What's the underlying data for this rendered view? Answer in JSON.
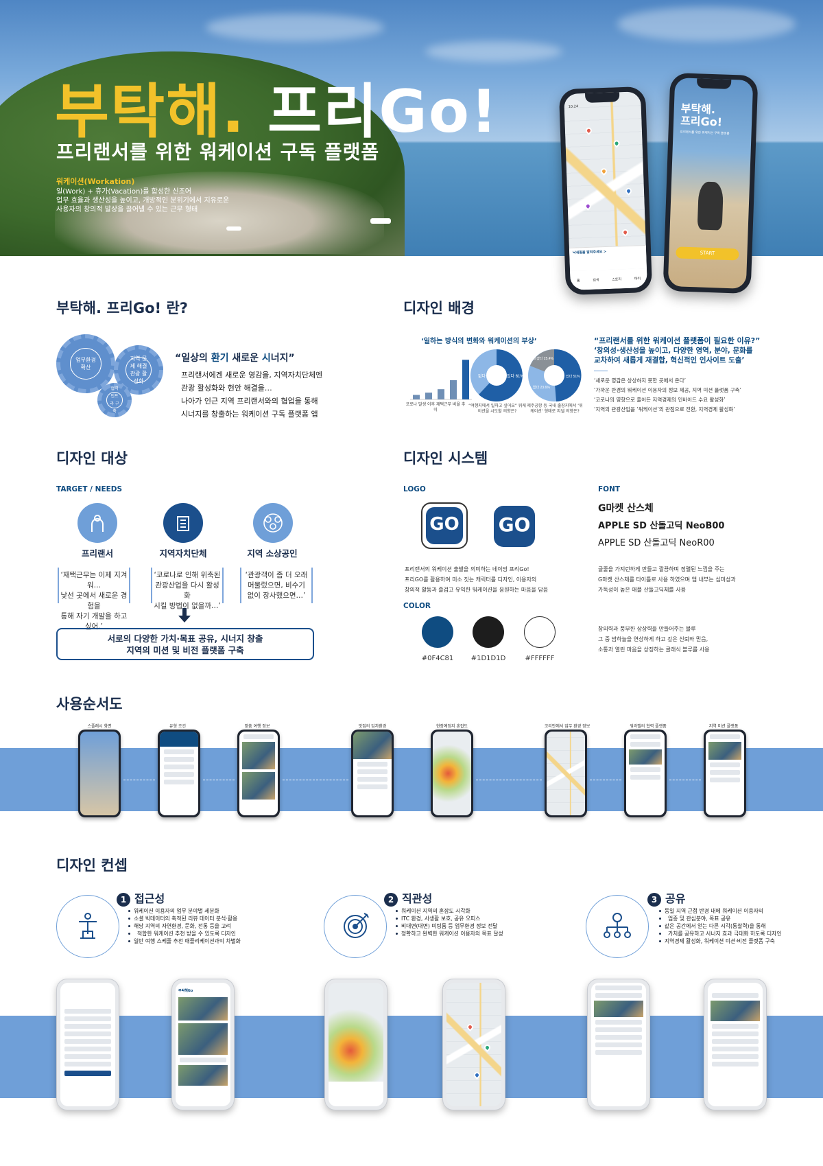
{
  "hero": {
    "title_yellow": "부탁해.",
    "title_white": "프리Go!",
    "subtitle": "프리랜서를 위한 워케이션 구독 플랫폼",
    "work_title": "워케이션(Workation)",
    "work_lines": [
      "일(Work) + 휴가(Vacation)를 합성한 신조어",
      "업무 효율과 생산성을 높이고, 개방적인 분위기에서 지유로운",
      "사용자의 창의적 발상을 끌어낼 수 있는 근무 형태"
    ],
    "phone1": {
      "time": "10:24",
      "label": "내 주변 여행지",
      "nav": [
        "홈",
        "검색",
        "스토리",
        "마이"
      ],
      "bottom_title": "낙새필을 알려주세요 >"
    },
    "phone2": {
      "title_line1": "부탁해.",
      "title_line2": "프리Go!",
      "subtitle": "프리랜서를 위한 워케이션 구독 플랫폼",
      "start": "START"
    }
  },
  "about": {
    "heading": "부탁해. 프리Go! 란?",
    "gears": [
      "업무환경 확산",
      "지역 문제 해결 관광 활성화",
      "협력 인프라 구축"
    ],
    "quote_prefix": "“일상의 ",
    "quote_bold1": "환기",
    "quote_mid": " 새로운 ",
    "quote_bold2": "시",
    "quote_suffix": "너지”",
    "body": [
      "프리랜서에겐 새로운 영감을, 지역자치단체엔",
      "관광 활성화와 현안 해결을…",
      "나아가 인근 지역 프리랜서와의 협업을 통해",
      "시너지를 창출하는 워케이션 구독 플랫폼 앱"
    ]
  },
  "background": {
    "heading": "디자인 배경",
    "chart_title": "‘일하는 방식의 변화와 워케이션의 부상’",
    "chart_caption1": "코로나 발생 이후 재택근무 비율 추이",
    "chart_caption2": "“여행지에서 일하고 싶어요” 워케이션을 시도할 의향은?",
    "chart_caption3": "제주공항 등 국내 출장지에서 ‘워케이션’ 형태로 지낼 의향은?",
    "pie1": {
      "labels": [
        "없다 39%",
        "있다 61%"
      ]
    },
    "pie2": {
      "labels": [
        "모르겠다 25.4%",
        "없다 23.6%",
        "있다 51%"
      ]
    },
    "quote_title": "“프리랜서를 위한 워케이션 플랫폼이 필요한 이유?”",
    "quote_sub": [
      "‘창의성·생산성을 높이고, 다양한 영역, 분야, 문화를",
      "교차하여 새롭게 재결합, 혁신적인 인사이트 도출’"
    ],
    "points": [
      "‘새로운 영감은 상상하지 못한 곳에서 온다’",
      "‘가까운 반경의 워케이션 이용자의 정보 제공, 지역 미션 플랫폼 구축’",
      "‘코로나의 영향으로 줄어든 지역경제의 인바이드 수요 활성화’",
      "‘지역의 관광산업을 ‘워케이션’의 관점으로 전환, 지역경제 활성화’"
    ]
  },
  "chart_data": {
    "type": "bar",
    "categories": [
      "",
      "",
      "",
      "",
      ""
    ],
    "values": [
      8,
      12,
      18,
      34,
      70
    ],
    "title": "",
    "xlabel": "",
    "ylabel": ""
  },
  "target": {
    "heading": "디자인 대상",
    "sub": "TARGET / NEEDS",
    "items": [
      {
        "label": "프리랜서",
        "quote": [
          "‘재택근무는 이제 지겨워…",
          "낯선 곳에서 새로운 경험을",
          "통해 자기 개발을 하고 싶어.’"
        ]
      },
      {
        "label": "지역자치단체",
        "quote": [
          "‘코로나로 인해 위축된",
          "관광산업을 다시 활성화",
          "시킬 방법이 없을까…’"
        ]
      },
      {
        "label": "지역 소상공인",
        "quote": [
          "‘관광객이 좀 더 오래",
          "머물렀으면, 비수기",
          "없이 장사했으면…’"
        ]
      }
    ],
    "result": [
      "서로의 다양한 가치·목표 공유, 시너지 창출",
      "지역의 미션 및 비전 플랫폼 구축"
    ]
  },
  "system": {
    "heading": "디자인 시스템",
    "logo_label": "LOGO",
    "logo_text": "GO",
    "logo_desc": [
      "프리랜서의 워케이션 출발을 의미하는 네이밍 프리Go!",
      "프리GO를 활용하여 미소 짓는 캐릭터를 디자인, 이용자의",
      "창의적 활동과 즐겁고 유익한 워케이션을 응원하는 마음을 담음"
    ],
    "font_label": "FONT",
    "fonts": [
      "G마켓 산스체",
      "APPLE SD 산돌고딕 NeoB00",
      "APPLE SD 산돌고딕 NeoR00"
    ],
    "font_desc": [
      "글줄을 가지런하게 만들고 깔끔하며 정렬된 느낌을 주는",
      "G마켓 산스체를 타이틀로 사용 하였으며 앱 내부는 심미성과",
      "가독성이 높은 애플 산돌고딕체를 사용"
    ],
    "color_label": "COLOR",
    "colors": [
      {
        "hex": "#0F4C81",
        "value": "#0f4c81"
      },
      {
        "hex": "#1D1D1D",
        "value": "#1d1d1d"
      },
      {
        "hex": "#FFFFFF",
        "value": "#ffffff"
      }
    ],
    "color_desc": [
      "창의력과 풍부한 상상력을 만들어주는 블루",
      "그 중 밤하늘을 연상하게 하고 깊은 신뢰와 믿음,",
      "소통과 열린 마음을 상징하는 클래식 블루를 사용"
    ]
  },
  "flow": {
    "heading": "사용순서도",
    "captions": [
      "스플래시 화면",
      "유형 조건",
      "맞춤 여행 정보",
      "맛집의 임차환경",
      "현장예정지 혼잡도",
      "코리안에서 업무 환경 정보",
      "워라밸의 협력 플랫폼",
      "지역 미션 플랫폼"
    ]
  },
  "concept": {
    "heading": "디자인 컨셉",
    "items": [
      {
        "num": "1",
        "title": "접근성",
        "bullets": [
          "워케이션 이용자의 업무 분야별 세분화",
          "소셜 빅데이터의 축적된 리뷰 데이터 분석·활용",
          "해당 지역의 자연환경, 문화, 전통 등을 고려",
          "적합한 워케이션 추천 받을 수 있도록 디자인",
          "일반 여행 스케줄 추천 애플리케이션과의 차별화"
        ]
      },
      {
        "num": "2",
        "title": "직관성",
        "bullets": [
          "워케이션 지역의 혼잡도 시각화",
          "ITC 환경, 사생활 보호, 공유 오피스",
          "비대면(대면) 미팅룸 등 업무환경 정보 전달",
          "정확하고 완벽한 워케이션 이용자의 목표 달성"
        ]
      },
      {
        "num": "3",
        "title": "공유",
        "bullets": [
          "동일 지역 근접 반경 내에 워케이션 이용자의",
          "업종 및 관심분야, 목표 공유",
          "같은 공간에서 얻는 다른 시각(통찰력)을 통해",
          "가치를 공유하고 시너지 효과 극대화 하도록 디자인",
          "지역경제 활성화, 워케이션 미션·비전 플랫폼 구축"
        ]
      }
    ],
    "screens": [
      "어떤 스타일의 워케이션을 계획하시나요?",
      "부탁해Go",
      "",
      "",
      "",
      "사용자 정보"
    ]
  }
}
